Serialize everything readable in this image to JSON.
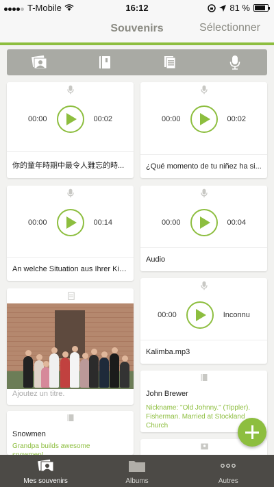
{
  "status": {
    "carrier": "T-Mobile",
    "time": "16:12",
    "battery": "81 %",
    "battery_level": 0.81
  },
  "navbar": {
    "title": "Souvenirs",
    "select_label": "Sélectionner"
  },
  "filters": [
    "photo-filter-icon",
    "story-filter-icon",
    "document-filter-icon",
    "audio-filter-icon"
  ],
  "cards": {
    "audio1": {
      "elapsed": "00:00",
      "duration": "00:02",
      "caption": "你的童年時期中最令人難忘的時..."
    },
    "audio2": {
      "elapsed": "00:00",
      "duration": "00:02",
      "caption": "¿Qué momento de tu niñez ha si..."
    },
    "audio3": {
      "elapsed": "00:00",
      "duration": "00:14",
      "caption": "An welche Situation aus Ihrer Kin..."
    },
    "audio4": {
      "elapsed": "00:00",
      "duration": "00:04",
      "caption": "Audio"
    },
    "audio5": {
      "elapsed": "00:00",
      "duration": "Inconnu",
      "caption": "Kalimba.mp3"
    },
    "photo1": {
      "placeholder": "Ajoutez un titre."
    },
    "story1": {
      "name": "John Brewer",
      "description": "Nickname: \"Old Johnny.\" (Tippler). Fisherman. Married at Stockland Church"
    },
    "story2": {
      "name": "Snowmen",
      "description": "Grandpa builds awesome snowmen!"
    }
  },
  "tabbar": {
    "tabs": [
      {
        "label": "Mes souvenirs"
      },
      {
        "label": "Albums"
      },
      {
        "label": "Autres"
      }
    ]
  },
  "colors": {
    "accent": "#8dbe3f",
    "tabbar": "#4c4a46",
    "filterbar": "#a9aaa4"
  }
}
